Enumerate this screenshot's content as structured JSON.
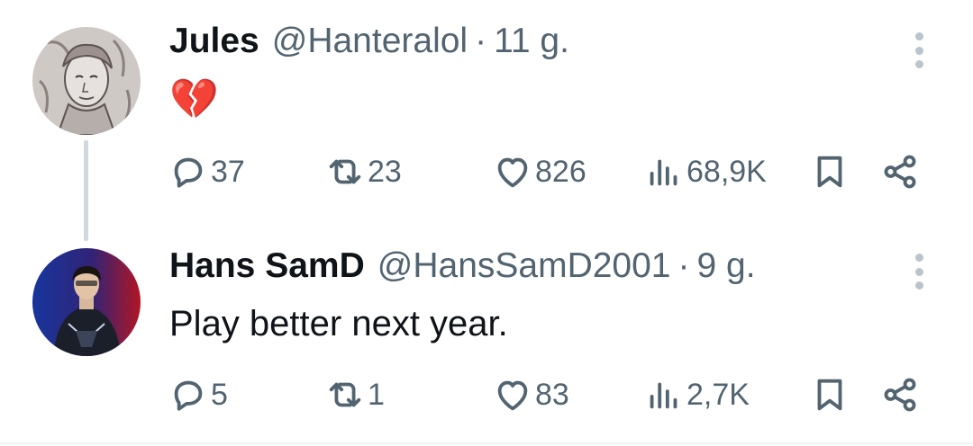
{
  "tweets": [
    {
      "name": "Jules",
      "handle": "@Hanteralol",
      "separator": "·",
      "time": "11 g.",
      "text": "💔",
      "avatar_icon": "sketch-portrait-avatar",
      "stats": {
        "replies": "37",
        "reposts": "23",
        "likes": "826",
        "views": "68,9K"
      }
    },
    {
      "name": "Hans SamD",
      "handle": "@HansSamD2001",
      "separator": "·",
      "time": "9 g.",
      "text": "Play better next year.",
      "avatar_icon": "esports-player-avatar",
      "stats": {
        "replies": "5",
        "reposts": "1",
        "likes": "83",
        "views": "2,7K"
      }
    }
  ],
  "colors": {
    "text": "#0f1419",
    "secondary": "#536471",
    "thread_line": "#cfd9de"
  }
}
